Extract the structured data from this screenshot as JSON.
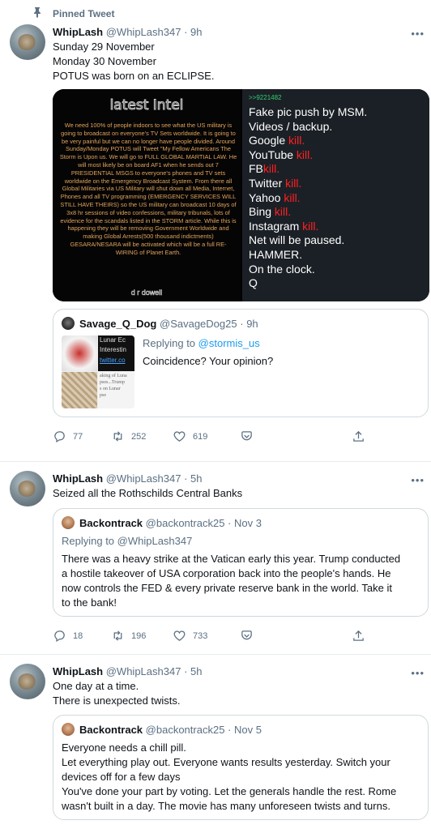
{
  "pinned": {
    "label": "Pinned Tweet"
  },
  "tweets": [
    {
      "name": "WhipLash",
      "handle": "@WhipLash347",
      "time": "9h",
      "lines": [
        "Sunday 29 November",
        "Monday 30 November",
        "POTUS was born on an ECLIPSE."
      ],
      "media": {
        "left_title": "latest Intel",
        "left_body": "We need 100% of people indoors to see what the US military is going to broadcast on everyone's TV Sets worldwide. It is going to be very painful but we can no longer have people divided. Around Sunday/Monday POTUS will Tweet \"My Fellow Americans The Storm is Upon us. We will go to FULL GLOBAL MARTIAL LAW. He will most likely be on board AF1 when he sends out 7 PRESIDENTIAL MSGS to everyone's phones and TV sets worldwide on the Emergency Broadcast System. From there all Global Militaries via US Military will shut down all Media, Internet, Phones and all TV programming (EMERGENCY SERVICES WILL STILL HAVE THEIRS) so the US military can broadcast 10 days of 3x8 hr sessions of video confessions, military tribunals, lots of evidence for the scandals listed in the STORM article. While this is happening they will be removing Government Worldwide and making Global Arrests(500 thousand indictments) GESARA/NESARA will be activated which will be a full RE-WIRING of Planet Earth.",
        "left_signature": "d r dowell",
        "right_header": ">>9221482",
        "right_lines": [
          {
            "pre": "Fake pic push by MSM.",
            "kill": ""
          },
          {
            "pre": "Videos / backup.",
            "kill": ""
          },
          {
            "pre": "Google ",
            "kill": "kill."
          },
          {
            "pre": "YouTube ",
            "kill": "kill."
          },
          {
            "pre": "FB",
            "kill": "kill."
          },
          {
            "pre": "Twitter ",
            "kill": "kill."
          },
          {
            "pre": "Yahoo ",
            "kill": "kill."
          },
          {
            "pre": "Bing ",
            "kill": "kill."
          },
          {
            "pre": "Instagram ",
            "kill": "kill."
          },
          {
            "pre": "Net will be paused.",
            "kill": ""
          },
          {
            "pre": "HAMMER.",
            "kill": ""
          },
          {
            "pre": "On the clock.",
            "kill": ""
          },
          {
            "pre": "Q",
            "kill": ""
          }
        ]
      },
      "quote": {
        "name": "Savage_Q_Dog",
        "handle": "@SavageDog25",
        "time": "9h",
        "reply_prefix": "Replying to ",
        "reply_to": "@stormis_us",
        "text": "Coincidence? Your opinion?",
        "thumb_lines": [
          "Lunar Ec",
          "Interestin",
          "twitter.co"
        ],
        "thumb_small": [
          "aking of Luna",
          "pses...Trump",
          "s on Lunar",
          "pse"
        ]
      },
      "stats": {
        "replies": "77",
        "retweets": "252",
        "likes": "619"
      }
    },
    {
      "name": "WhipLash",
      "handle": "@WhipLash347",
      "time": "5h",
      "lines": [
        "Seized all the Rothschilds Central Banks"
      ],
      "quote": {
        "name": "Backontrack",
        "handle": "@backontrack25",
        "time": "Nov 3",
        "reply_prefix": "Replying to @WhipLash347",
        "lines": [
          "There was a heavy strike at the Vatican early this year.  Trump conducted",
          "a hostile takeover of USA corporation back into the people's hands.  He",
          "now controls the FED & every private reserve bank in the world.  Take it",
          "to the bank!"
        ]
      },
      "stats": {
        "replies": "18",
        "retweets": "196",
        "likes": "733"
      }
    },
    {
      "name": "WhipLash",
      "handle": "@WhipLash347",
      "time": "5h",
      "lines": [
        "One day at a time.",
        "There is unexpected twists."
      ],
      "quote": {
        "name": "Backontrack",
        "handle": "@backontrack25",
        "time": "Nov 5",
        "lines": [
          "Everyone needs a chill pill.",
          "Let everything play out.  Everyone wants results yesterday.  Switch your",
          "devices off for a few days",
          "You've done your part by voting.  Let the generals handle the rest.  Rome",
          "wasn't built in a day.  The movie has many unforeseen twists and turns."
        ]
      }
    }
  ],
  "separator": "·",
  "more": "•••"
}
